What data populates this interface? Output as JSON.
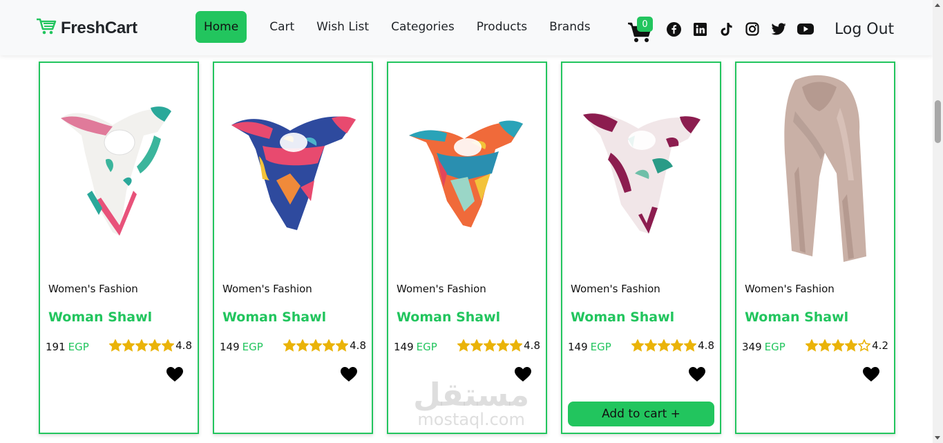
{
  "nav": {
    "brand": "FreshCart",
    "links": [
      {
        "label": "Home",
        "active": true
      },
      {
        "label": "Cart"
      },
      {
        "label": "Wish List"
      },
      {
        "label": "Categories"
      },
      {
        "label": "Products"
      },
      {
        "label": "Brands"
      }
    ],
    "cart_count": "0",
    "social_icons": [
      "facebook-icon",
      "linkedin-icon",
      "tiktok-icon",
      "instagram-icon",
      "twitter-icon",
      "youtube-icon"
    ],
    "logout": "Log Out"
  },
  "colors": {
    "accent": "#22c55e",
    "star": "#eab308",
    "navbar_bg": "#f8f9fa"
  },
  "products": [
    {
      "category": "Women's Fashion",
      "title": "Woman Shawl",
      "price": "191",
      "currency": "EGP",
      "rating": "4.8",
      "rating_value": 4.8,
      "show_add_to_cart": false
    },
    {
      "category": "Women's Fashion",
      "title": "Woman Shawl",
      "price": "149",
      "currency": "EGP",
      "rating": "4.8",
      "rating_value": 4.8,
      "show_add_to_cart": false
    },
    {
      "category": "Women's Fashion",
      "title": "Woman Shawl",
      "price": "149",
      "currency": "EGP",
      "rating": "4.8",
      "rating_value": 4.8,
      "show_add_to_cart": false
    },
    {
      "category": "Women's Fashion",
      "title": "Woman Shawl",
      "price": "149",
      "currency": "EGP",
      "rating": "4.8",
      "rating_value": 4.8,
      "show_add_to_cart": true
    },
    {
      "category": "Women's Fashion",
      "title": "Woman Shawl",
      "price": "349",
      "currency": "EGP",
      "rating": "4.2",
      "rating_value": 4.2,
      "show_add_to_cart": false
    }
  ],
  "add_to_cart_label": "Add to cart +",
  "watermark": {
    "arabic": "مستقل",
    "latin": "mostaql.com"
  }
}
